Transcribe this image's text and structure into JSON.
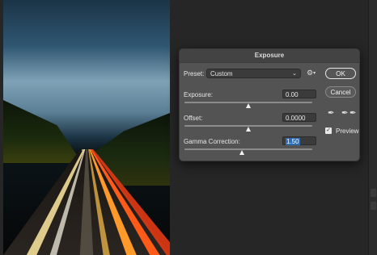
{
  "dialog": {
    "title": "Exposure",
    "preset_label": "Preset:",
    "preset_value": "Custom",
    "settings_icon": "gear-icon",
    "exposure_label": "Exposure:",
    "exposure_value": "0.00",
    "exposure_level": 0.5,
    "offset_label": "Offset:",
    "offset_value": "0.0000",
    "offset_level": 0.5,
    "gamma_label": "Gamma Correction:",
    "gamma_value": "1.50",
    "gamma_level": 0.45,
    "ok_label": "OK",
    "cancel_label": "Cancel",
    "eyedroppers": [
      "black-point-eyedropper-icon",
      "gray-point-eyedropper-icon",
      "white-point-eyedropper-icon"
    ],
    "preview_label": "Preview",
    "preview_checked": true
  },
  "colors": {
    "canvas_bg": "#262626",
    "dialog_bg": "#535353",
    "highlight": "#2f6bb0"
  }
}
